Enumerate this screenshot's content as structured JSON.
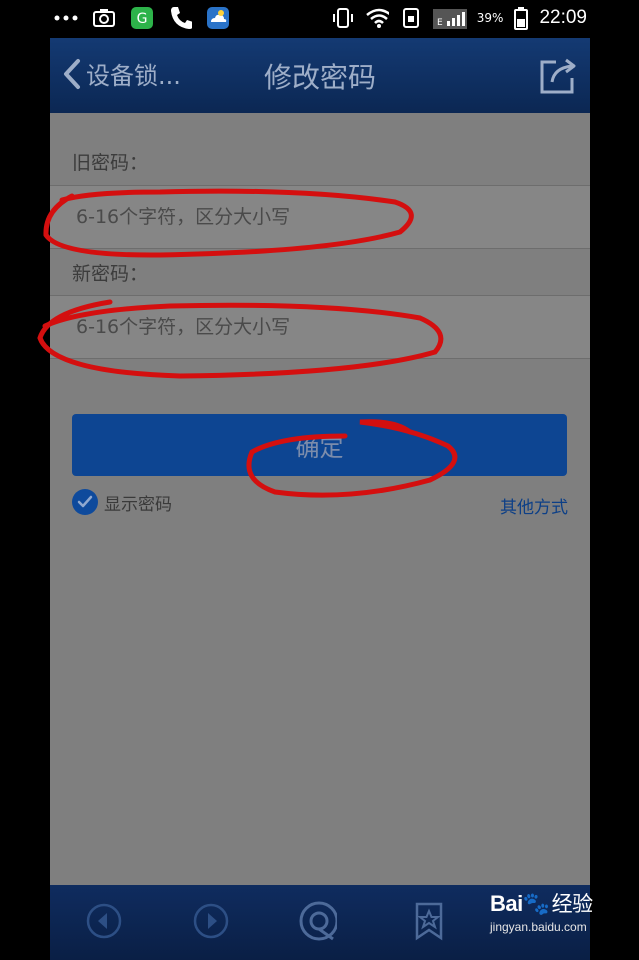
{
  "status_bar": {
    "battery_percent": "39%",
    "time": "22:09",
    "network": "E",
    "icons": [
      "more-dots-icon",
      "screenshot-icon",
      "app-badge-icon",
      "phone-icon",
      "weather-icon",
      "vibrate-icon",
      "wifi-icon",
      "sim-icon",
      "signal-icon",
      "battery-icon"
    ]
  },
  "header": {
    "back_label": "设备锁...",
    "title": "修改密码",
    "share_icon": "share-icon"
  },
  "form": {
    "old_password_label": "旧密码：",
    "old_password_value": "",
    "old_password_placeholder": "6-16个字符，区分大小写",
    "new_password_label": "新密码：",
    "new_password_value": "",
    "new_password_placeholder": "6-16个字符，区分大小写",
    "confirm_label": "确定",
    "show_password_label": "显示密码",
    "show_password_checked": true,
    "other_method_label": "其他方式"
  },
  "bottom_bar": {
    "icons": [
      "back-arrow-icon",
      "forward-arrow-icon",
      "browser-home-icon",
      "bookmark-star-icon"
    ]
  },
  "watermark": {
    "logo": "Bai",
    "logo_suffix": "经验",
    "url": "jingyan.baidu.com"
  },
  "colors": {
    "header_bg": "#0d2b5c",
    "confirm_bg": "#0d4592",
    "content_bg": "#7f7f7f",
    "annotation": "#d40f0f",
    "link": "#0c3f87"
  }
}
